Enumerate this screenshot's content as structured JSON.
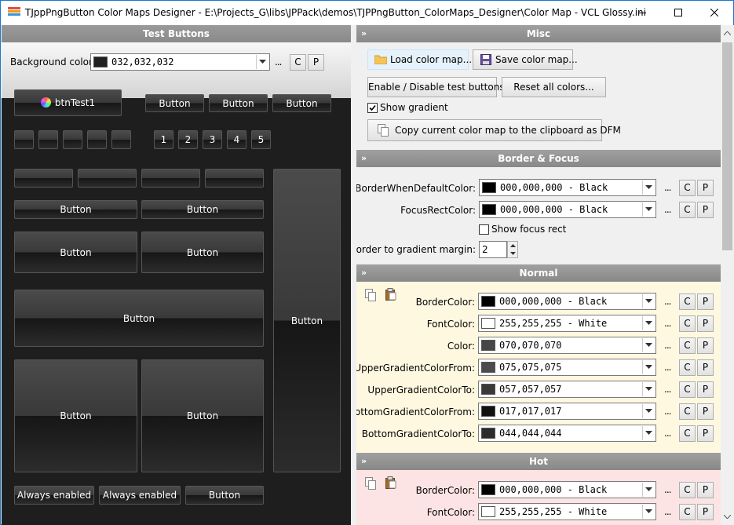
{
  "window": {
    "title": "TJppPngButton Color Maps Designer - E:\\Projects_G\\libs\\JPPack\\demos\\TJPPngButton_ColorMaps_Designer\\Color Map - VCL Glossy.ini",
    "minimize_icon": "minimize-icon",
    "maximize_icon": "maximize-icon",
    "close_icon": "close-icon"
  },
  "left_panel": {
    "header": "Test Buttons",
    "background_color_label": "Background color:",
    "background_color_value": "032,032,032",
    "background_color_hex": "#202020",
    "dots": "...",
    "copy_btn": "C",
    "paste_btn": "P",
    "btn_test1": "btnTest1",
    "button": "Button",
    "numbered": [
      "1",
      "2",
      "3",
      "4",
      "5"
    ],
    "always_enabled": "Always enabled"
  },
  "misc": {
    "header": "Misc",
    "load": "Load color map...",
    "save": "Save color map...",
    "enable_disable": "Enable / Disable test buttons",
    "reset": "Reset all colors...",
    "show_gradient": "Show gradient",
    "show_gradient_checked": true,
    "copy_dfm": "Copy current color map to the clipboard as DFM"
  },
  "border_focus": {
    "header": "Border & Focus",
    "rows": [
      {
        "label": "BorderWhenDefaultColor:",
        "value": "000,000,000  -  Black",
        "hex": "#000000"
      },
      {
        "label": "FocusRectColor:",
        "value": "000,000,000  -  Black",
        "hex": "#000000"
      }
    ],
    "show_focus_rect": "Show focus rect",
    "margin_label": "Border to gradient margin:",
    "margin_value": "2"
  },
  "normal": {
    "header": "Normal",
    "bg": "#fff8e1",
    "rows": [
      {
        "label": "BorderColor:",
        "value": "000,000,000  -  Black",
        "hex": "#000000"
      },
      {
        "label": "FontColor:",
        "value": "255,255,255  -  White",
        "hex": "#ffffff"
      },
      {
        "label": "Color:",
        "value": "070,070,070",
        "hex": "#464646"
      },
      {
        "label": "UpperGradientColorFrom:",
        "value": "075,075,075",
        "hex": "#4b4b4b"
      },
      {
        "label": "UpperGradientColorTo:",
        "value": "057,057,057",
        "hex": "#393939"
      },
      {
        "label": "BottomGradientColorFrom:",
        "value": "017,017,017",
        "hex": "#111111"
      },
      {
        "label": "BottomGradientColorTo:",
        "value": "044,044,044",
        "hex": "#2c2c2c"
      }
    ]
  },
  "hot": {
    "header": "Hot",
    "bg": "#fde4e4",
    "rows": [
      {
        "label": "BorderColor:",
        "value": "000,000,000  -  Black",
        "hex": "#000000"
      },
      {
        "label": "FontColor:",
        "value": "255,255,255  -  White",
        "hex": "#ffffff"
      }
    ]
  }
}
